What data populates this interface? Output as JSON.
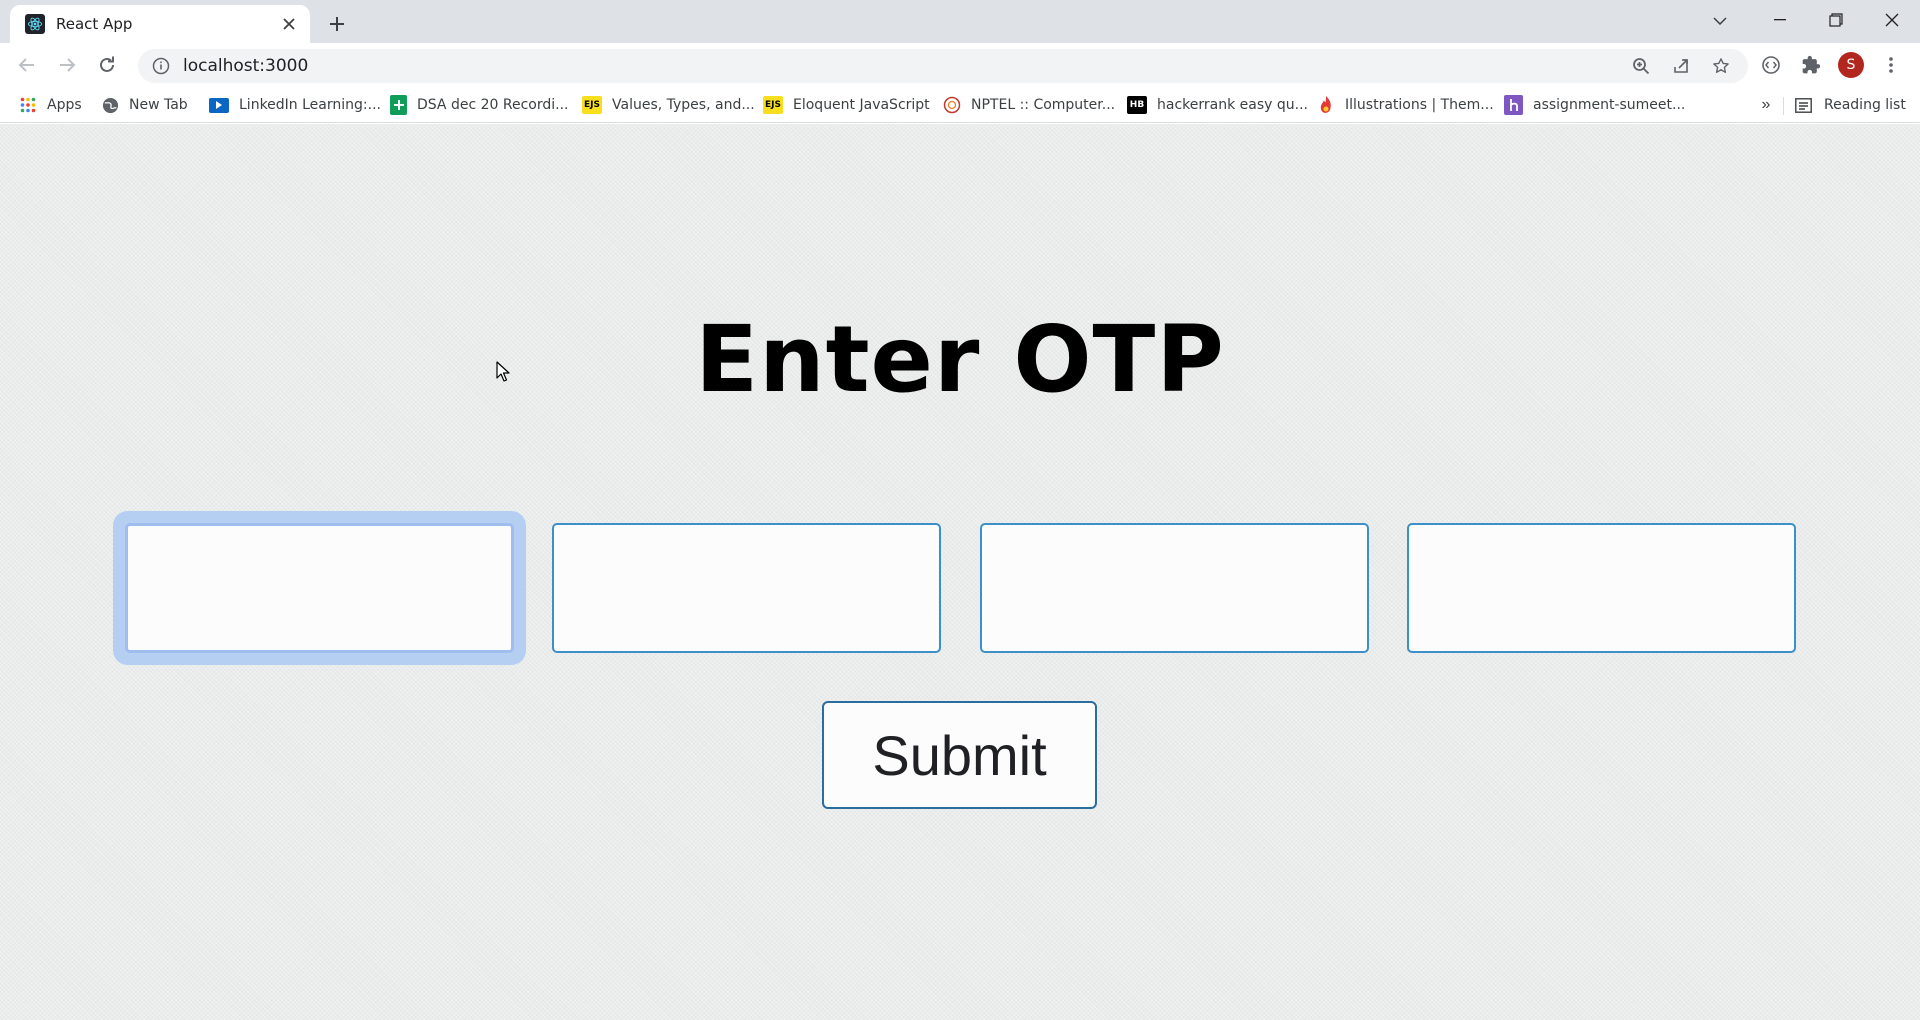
{
  "browser": {
    "tab": {
      "title": "React App",
      "favicon": "react-icon"
    },
    "address": {
      "url": "localhost:3000"
    },
    "profile_initial": "S",
    "bookmarks": [
      {
        "label": "Apps",
        "icon": "apps-grid-icon"
      },
      {
        "label": "New Tab",
        "icon": "globe-icon"
      },
      {
        "label": "LinkedIn Learning:...",
        "icon": "linkedin-learning-icon"
      },
      {
        "label": "DSA dec 20 Recordi...",
        "icon": "sheets-icon"
      },
      {
        "label": "Values, Types, and...",
        "icon": "ejs-icon",
        "badge": "EJS"
      },
      {
        "label": "Eloquent JavaScript",
        "icon": "ejs-icon",
        "badge": "EJS"
      },
      {
        "label": "NPTEL :: Computer...",
        "icon": "nptel-icon"
      },
      {
        "label": "hackerrank easy qu...",
        "icon": "hackerrank-icon",
        "badge": "HB"
      },
      {
        "label": "Illustrations | Them...",
        "icon": "illustrations-icon"
      },
      {
        "label": "assignment-sumeet...",
        "icon": "heroku-icon"
      }
    ],
    "overflow_label": "»",
    "reading_list": "Reading list"
  },
  "page": {
    "heading": "Enter OTP",
    "otp_inputs": [
      {
        "value": "",
        "focused": true
      },
      {
        "value": "",
        "focused": false
      },
      {
        "value": "",
        "focused": false
      },
      {
        "value": "",
        "focused": false
      }
    ],
    "submit_label": "Submit"
  },
  "colors": {
    "input_border": "#3d8fc9",
    "focus_ring": "#b5cff3",
    "button_border": "#2b6d9e",
    "page_background": "#eaeceb"
  }
}
